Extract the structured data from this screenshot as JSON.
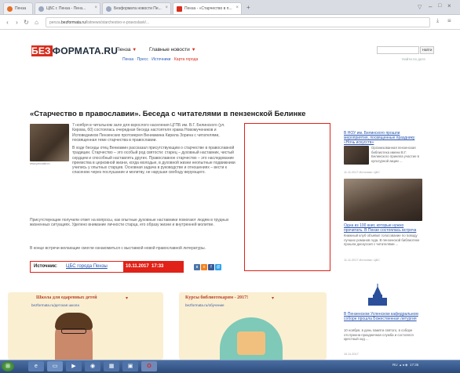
{
  "browser": {
    "tabs": [
      {
        "label": "Пенза"
      },
      {
        "label": "ЦБС г. Пенза - Пенз..."
      },
      {
        "label": "Безформата новости Пе..."
      },
      {
        "label": "Пенза - «Старчество в п..."
      }
    ],
    "new_tab": "+",
    "url_prefix": "penza.",
    "url_domain": "bezformata.ru",
    "url_rest": "/listnews/starchestvo-v-pravoslavii/..."
  },
  "site": {
    "logo_left": "БЕЗ",
    "logo_right": "ФОРМАТА.RU",
    "city_menu": "Пенза",
    "news_menu": "Главные новости",
    "subnav": [
      "Пенза",
      "Пресс",
      "Источники",
      "Карта города"
    ],
    "search_button": "Найти",
    "advanced_search": "Найти по дате"
  },
  "article": {
    "title": "«Старчество в православии». Беседа с читателями в пензенской Белинке",
    "photo_caption": "www.penzalib.ru",
    "para1": "7 ноября в читальном зале для взрослого населения ЦГПБ им. В.Г. Белинского (ул. Кирова, 60) состоялась очередная беседа настоятеля храма Новомучеников и Исповедников Пензенских протоиерея Вениамина Кирила Зорина с читателями, посвященная теме старчества в православии.",
    "para2": "В ходе беседы отец Вениамин рассказал присутствующим о старчестве в православной традиции. Старчество – это особый род святости: старец – духовный наставник, чистый сердцем и способный наставлять других. Православное старчество – это наследование преемства в церковной жизни, когда молодые, в духовной жизни неопытные подвижники учились у опытных старцев. Основная задача в руководстве и отношениях – вести к спасению через послушание и молитву, не нарушая свободу верующего.",
    "para3": "Присутствующие получили ответ на вопросы, как опытные духовные наставники помогают людям в трудных жизненных ситуациях. Уделено внимание личности старца, его образу жизни и внутренней молитве.",
    "para4": "В конце встречи желающие смогли ознакомиться с выставкой новой православной литературы.",
    "source_label": "Источник:",
    "source_name": "ЦБС города Пензы",
    "date": "10.11.2017",
    "time": "17:33"
  },
  "sidebar": [
    {
      "title": "В НОУ им. Белинского прошли мероприятия, посвященные празднику «Ночь искусств»",
      "text": "Организованная пензенская библиотека имени В.Г. Белинского приняла участие в культурной акции ...",
      "date": "11.11.2017 Источник: ЦБС"
    },
    {
      "title": "Одна из 100 книг, которые нужно прочитать. В Пензе состоялась встреча",
      "text": "Книжный клуб объявил голосование по поводу лучших романов года. В пензенской библиотеке прошла дискуссия с читателями ...",
      "date": "11.11.2017 Источник: ЦБС"
    },
    {
      "title": "В Пензенском Успенском кафедральном соборе прошла Божественная литургия",
      "text": "10 ноября, в день памяти святого, в соборе отслужена праздничная служба и состоялся крестный ход ...",
      "date": "10.11.2017"
    }
  ],
  "blocks": [
    {
      "title": "Школа для одаренных детей",
      "sub": "bezformata.ru/детская школа"
    },
    {
      "title": "Курсы библиотекарям - 2017!",
      "sub": "bezformata.ru/обучение"
    }
  ],
  "taskbar": {
    "clock": "17:35",
    "lang": "RU"
  },
  "colors": {
    "brand_red": "#d72d1d",
    "link_blue": "#2a56b0",
    "block_bg": "#fbefd2"
  }
}
